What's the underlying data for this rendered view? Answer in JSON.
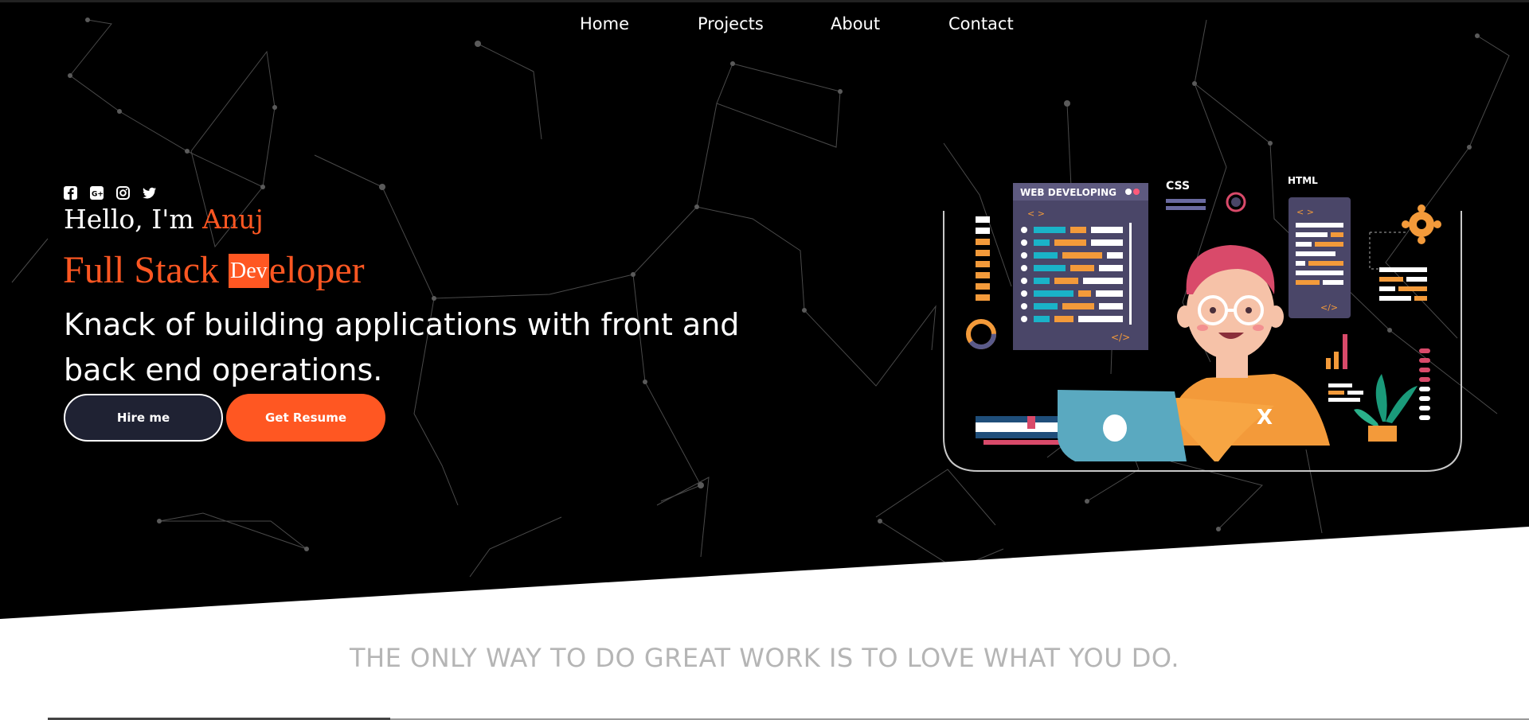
{
  "nav": {
    "home": "Home",
    "projects": "Projects",
    "about": "About",
    "contact": "Contact"
  },
  "socials": [
    "facebook-icon",
    "google-plus-icon",
    "instagram-icon",
    "twitter-icon"
  ],
  "hero": {
    "greeting": "Hello, I'm",
    "name": "Anuj",
    "role_prefix": "Full Stack ",
    "role_highlight": "Dev",
    "role_suffix": "eloper",
    "tagline": "Knack of building applications with front and back end operations.",
    "hire_label": "Hire me",
    "resume_label": "Get Resume"
  },
  "illustration": {
    "panel_title": "WEB DEVELOPING",
    "css_label": "CSS",
    "html_label": "HTML",
    "code_tag_open": "< >",
    "code_tag_close": "</>",
    "x_mark": "X"
  },
  "quote": "THE ONLY WAY TO DO GREAT WORK IS TO LOVE WHAT YOU DO.",
  "colors": {
    "accent": "#ff5722",
    "background": "#000000",
    "button_dark": "#1f2233",
    "quote": "#b5b5b5"
  }
}
